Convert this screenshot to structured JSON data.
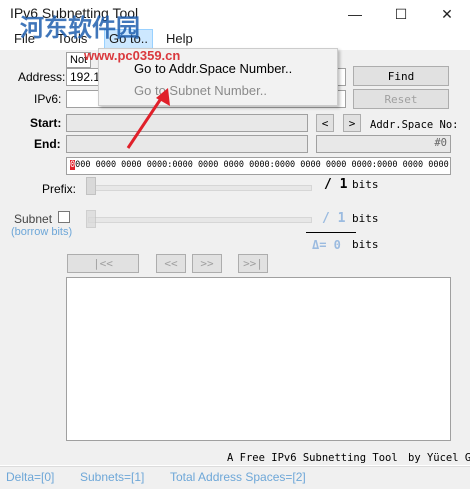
{
  "window": {
    "title": "IPv6 Subnetting Tool",
    "minimize_icon": "minimize-icon",
    "maximize_icon": "maximize-icon",
    "close_icon": "close-icon"
  },
  "menu": {
    "items": [
      "File",
      "Tools",
      "Go to..",
      "Help"
    ]
  },
  "dropdown": {
    "items": [
      "Go to Addr.Space Number..",
      "Go to Subnet Number.."
    ]
  },
  "status_flag": "Not",
  "address": {
    "label": "Address:",
    "value": "192.16",
    "find_label": "Find",
    "reset_label": "Reset"
  },
  "ipv6": {
    "label": "IPv6:",
    "value": ""
  },
  "start": {
    "label": "Start:",
    "prev_label": "<",
    "next_label": ">",
    "addr_space_label": "Addr.Space No:"
  },
  "end": {
    "label": "End:",
    "addr_space_value": "#0"
  },
  "binary": {
    "highlight": "0",
    "rest": "000 0000 0000 0000:0000 0000 0000 0000:0000 0000 0000 0000:0000 0000 0000 0000"
  },
  "prefix": {
    "label": "Prefix:",
    "value": "/ 1",
    "unit": "bits"
  },
  "subnet": {
    "label": "Subnet",
    "sublabel": "(borrow bits)",
    "value": "/ 1",
    "unit": "bits",
    "delta_label": "Δ= 0",
    "delta_unit": "bits"
  },
  "nav_buttons": [
    "|<<",
    "<<",
    ">>",
    ">>|"
  ],
  "footer": {
    "tool_name": "A Free IPv6 Subnetting Tool",
    "author": "by Yücel G"
  },
  "status": {
    "delta": "Delta=[0]",
    "subnets": "Subnets=[1]",
    "total": "Total Address Spaces=[2]"
  },
  "watermark": {
    "text": "河东软件园",
    "url": "www.pc0359.cn"
  },
  "colors": {
    "accent": "#cde8ff",
    "arrow": "#e0202a",
    "status_text": "#6ea7d8",
    "panel": "#f0f0f0"
  }
}
